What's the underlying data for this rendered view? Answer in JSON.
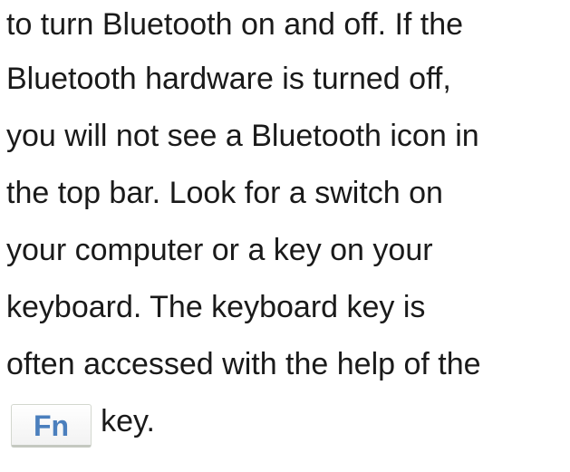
{
  "paragraph": {
    "lines": [
      "to turn Bluetooth on and off. If the",
      "Bluetooth hardware is turned off,",
      "you will not see a Bluetooth icon in",
      "the top bar. Look for a switch on",
      "your computer or a key on your",
      "keyboard. The keyboard key is",
      "often accessed with the help of the"
    ],
    "key_label": "Fn",
    "last_line_suffix": "key."
  },
  "colors": {
    "text": "#1a1a1a",
    "key_text": "#4b7fbd",
    "key_border": "#d3d7cf",
    "background": "#ffffff"
  }
}
